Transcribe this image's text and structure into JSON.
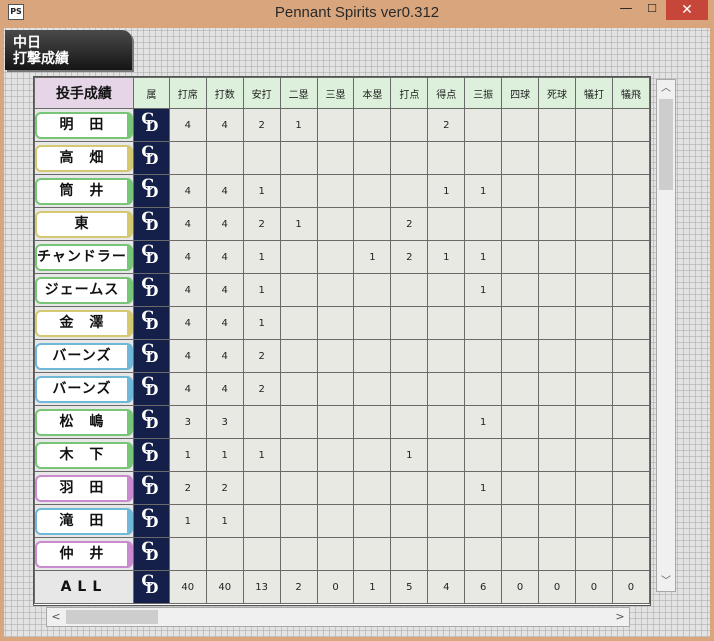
{
  "window": {
    "title": "Pennant Spirits ver0.312",
    "icon_name": "app-icon",
    "min_glyph": "—",
    "max_glyph": "☐",
    "close_glyph": "✕"
  },
  "team_tag": {
    "line1": "中日",
    "line2": "打撃成績"
  },
  "table": {
    "corner_label": "投手成績",
    "columns": [
      "属",
      "打席",
      "打数",
      "安打",
      "二塁",
      "三塁",
      "本塁",
      "打点",
      "得点",
      "三振",
      "四球",
      "死球",
      "犠打",
      "犠飛"
    ],
    "rows": [
      {
        "name": "明　田",
        "color": "green",
        "values": [
          "4",
          "4",
          "2",
          "1",
          "",
          "",
          "",
          "2",
          "",
          "",
          "",
          "",
          ""
        ]
      },
      {
        "name": "高　畑",
        "color": "yellow",
        "values": [
          "",
          "",
          "",
          "",
          "",
          "",
          "",
          "",
          "",
          "",
          "",
          "",
          ""
        ]
      },
      {
        "name": "筒　井",
        "color": "green",
        "values": [
          "4",
          "4",
          "1",
          "",
          "",
          "",
          "",
          "1",
          "1",
          "",
          "",
          "",
          ""
        ]
      },
      {
        "name": "東",
        "color": "yellow",
        "values": [
          "4",
          "4",
          "2",
          "1",
          "",
          "",
          "2",
          "",
          "",
          "",
          "",
          "",
          ""
        ]
      },
      {
        "name": "チャンドラー",
        "color": "green",
        "values": [
          "4",
          "4",
          "1",
          "",
          "",
          "1",
          "2",
          "1",
          "1",
          "",
          "",
          "",
          ""
        ]
      },
      {
        "name": "ジェームス",
        "color": "green",
        "values": [
          "4",
          "4",
          "1",
          "",
          "",
          "",
          "",
          "",
          "1",
          "",
          "",
          "",
          ""
        ]
      },
      {
        "name": "金　澤",
        "color": "yellow",
        "values": [
          "4",
          "4",
          "1",
          "",
          "",
          "",
          "",
          "",
          "",
          "",
          "",
          "",
          ""
        ]
      },
      {
        "name": "バーンズ",
        "color": "blue",
        "values": [
          "4",
          "4",
          "2",
          "",
          "",
          "",
          "",
          "",
          "",
          "",
          "",
          "",
          ""
        ]
      },
      {
        "name": "バーンズ",
        "color": "blue",
        "values": [
          "4",
          "4",
          "2",
          "",
          "",
          "",
          "",
          "",
          "",
          "",
          "",
          "",
          ""
        ]
      },
      {
        "name": "松　嶋",
        "color": "green",
        "values": [
          "3",
          "3",
          "",
          "",
          "",
          "",
          "",
          "",
          "1",
          "",
          "",
          "",
          ""
        ]
      },
      {
        "name": "木　下",
        "color": "green",
        "values": [
          "1",
          "1",
          "1",
          "",
          "",
          "",
          "1",
          "",
          "",
          "",
          "",
          "",
          ""
        ]
      },
      {
        "name": "羽　田",
        "color": "purple",
        "values": [
          "2",
          "2",
          "",
          "",
          "",
          "",
          "",
          "",
          "1",
          "",
          "",
          "",
          ""
        ]
      },
      {
        "name": "滝　田",
        "color": "blue",
        "values": [
          "1",
          "1",
          "",
          "",
          "",
          "",
          "",
          "",
          "",
          "",
          "",
          "",
          ""
        ]
      },
      {
        "name": "仲　井",
        "color": "purple",
        "values": [
          "",
          "",
          "",
          "",
          "",
          "",
          "",
          "",
          "",
          "",
          "",
          "",
          ""
        ]
      }
    ],
    "total": {
      "name": "ALL",
      "values": [
        "40",
        "40",
        "13",
        "2",
        "0",
        "1",
        "5",
        "4",
        "6",
        "0",
        "0",
        "0",
        "0"
      ]
    },
    "logo_glyphs": {
      "c": "C",
      "d": "D",
      "icon_name": "dragons-cd-logo-icon"
    }
  },
  "scrollbars": {
    "up_glyph": "︿",
    "down_glyph": "﹀",
    "left_glyph": "<",
    "right_glyph": ">"
  },
  "colors": {
    "green": "#77c677",
    "yellow": "#d4c870",
    "blue": "#6fb8da",
    "purple": "#c98ad0",
    "header_bg": "#dcf0dc",
    "corner_bg": "#e6d5e6",
    "logo_bg": "#14204a"
  }
}
